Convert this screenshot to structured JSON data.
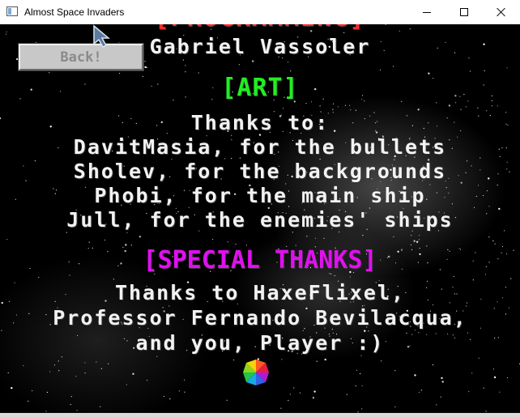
{
  "window": {
    "title": "Almost Space Invaders",
    "controls": {
      "minimize": "minimize-icon",
      "maximize": "maximize-icon",
      "close": "close-icon"
    }
  },
  "colors": {
    "background": "#000000",
    "text_white": "#f2f2f2",
    "heading_green": "#22ee22",
    "heading_magenta": "#e010f0",
    "heading_red": "#ff2a2a",
    "button_face": "#c8c8c8"
  },
  "back_button": {
    "label": "Back!"
  },
  "credits": {
    "cut_heading": "[PROGRAMMING]",
    "programmer": "Gabriel Vassoler",
    "art_heading": "[ART]",
    "art_lines": [
      "Thanks to:",
      "DavitMasia, for the bullets",
      "Sholev, for the backgrounds",
      "Phobi, for the main ship",
      "Jull, for the enemies' ships"
    ],
    "special_heading": "[SPECIAL THANKS]",
    "special_lines": [
      "Thanks to HaxeFlixel,",
      "Professor Fernando Bevilacqua,",
      "and you, Player :)"
    ]
  },
  "icons": {
    "logo": "haxeflixel-logo-icon",
    "cursor": "mouse-cursor-icon"
  }
}
